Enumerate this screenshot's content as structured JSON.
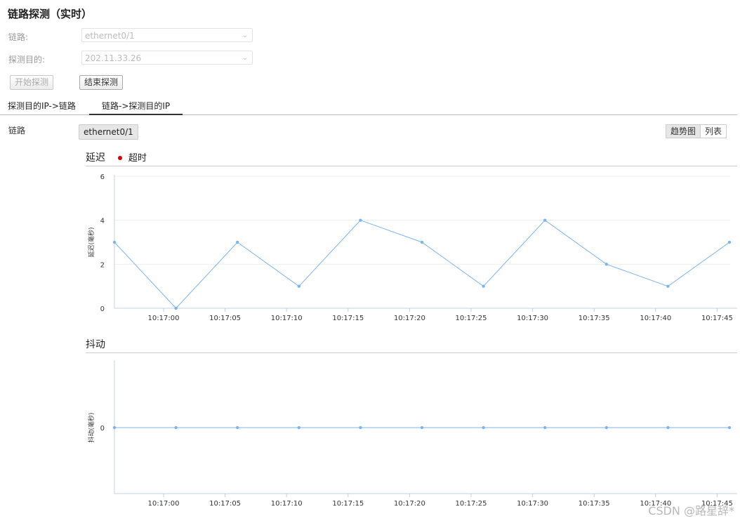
{
  "page_title": "链路探测（实时）",
  "form": {
    "link_label": "链路:",
    "link_value": "ethernet0/1",
    "target_label": "探测目的:",
    "target_value": "202.11.33.26"
  },
  "buttons": {
    "start": "开始探测",
    "stop": "结束探测"
  },
  "tabs": [
    {
      "label": "探测目的IP->链路",
      "active": false
    },
    {
      "label": "链路->探测目的IP",
      "active": true
    }
  ],
  "link_row": {
    "label": "链路",
    "chip": "ethernet0/1"
  },
  "view_toggle": {
    "trend": "趋势图",
    "list": "列表",
    "selected": "趋势图"
  },
  "latency": {
    "title": "延迟",
    "legend": "超时",
    "legend_color": "#d50000",
    "chart_data": {
      "type": "line",
      "x": [
        "10:16:56",
        "10:17:01",
        "10:17:06",
        "10:17:11",
        "10:17:16",
        "10:17:21",
        "10:17:26",
        "10:17:31",
        "10:17:36",
        "10:17:41",
        "10:17:46"
      ],
      "values": [
        3,
        0,
        3,
        1,
        4,
        3,
        1,
        4,
        2,
        1,
        3
      ],
      "ylabel": "延迟(毫秒)",
      "ylim": [
        0,
        6
      ],
      "yticks": [
        0,
        2,
        4,
        6
      ],
      "xticks": [
        "10:17:00",
        "10:17:05",
        "10:17:10",
        "10:17:15",
        "10:17:20",
        "10:17:25",
        "10:17:30",
        "10:17:35",
        "10:17:40",
        "10:17:45"
      ],
      "line_color": "#7cb5ec"
    }
  },
  "jitter": {
    "title": "抖动",
    "chart_data": {
      "type": "line",
      "x": [
        "10:16:56",
        "10:17:01",
        "10:17:06",
        "10:17:11",
        "10:17:16",
        "10:17:21",
        "10:17:26",
        "10:17:31",
        "10:17:36",
        "10:17:41",
        "10:17:46"
      ],
      "values": [
        0,
        0,
        0,
        0,
        0,
        0,
        0,
        0,
        0,
        0,
        0
      ],
      "ylabel": "抖动(毫秒)",
      "yticks": [
        0
      ],
      "xticks": [
        "10:17:00",
        "10:17:05",
        "10:17:10",
        "10:17:15",
        "10:17:20",
        "10:17:25",
        "10:17:30",
        "10:17:35",
        "10:17:40",
        "10:17:45"
      ],
      "line_color": "#7cb5ec"
    }
  },
  "watermark": "CSDN @路星辞*"
}
